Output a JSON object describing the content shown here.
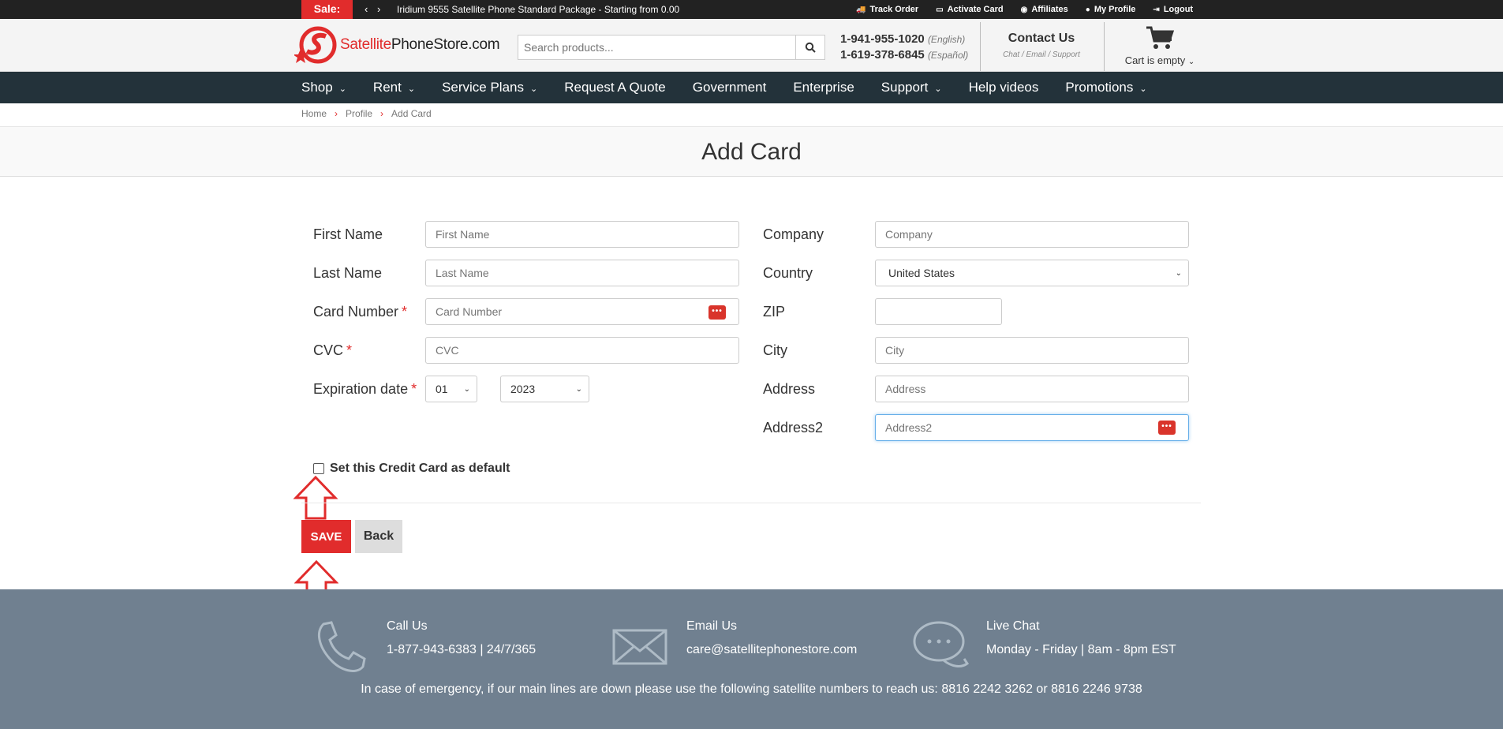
{
  "topbar": {
    "sale_label": "Sale:",
    "sale_arrows": "‹ ›",
    "sale_text": "Iridium 9555 Satellite Phone Standard Package - Starting from 0.00",
    "links": [
      "Track Order",
      "Activate Card",
      "Affiliates",
      "My Profile",
      "Logout"
    ]
  },
  "header": {
    "logo_text_1": "Satellite",
    "logo_text_2": "PhoneStore",
    "logo_text_3": ".com",
    "search_placeholder": "Search products...",
    "phone_en": "1-941-955-1020",
    "phone_en_lang": "(English)",
    "phone_es": "1-619-378-6845",
    "phone_es_lang": "(Español)",
    "contact_title": "Contact Us",
    "contact_sub": "Chat / Email / Support",
    "cart_label": "Cart is empty"
  },
  "nav": {
    "items": [
      {
        "label": "Shop",
        "dropdown": true
      },
      {
        "label": "Rent",
        "dropdown": true
      },
      {
        "label": "Service Plans",
        "dropdown": true
      },
      {
        "label": "Request A Quote",
        "dropdown": false
      },
      {
        "label": "Government",
        "dropdown": false
      },
      {
        "label": "Enterprise",
        "dropdown": false
      },
      {
        "label": "Support",
        "dropdown": true
      },
      {
        "label": "Help videos",
        "dropdown": false
      },
      {
        "label": "Promotions",
        "dropdown": true
      }
    ]
  },
  "breadcrumb": [
    "Home",
    "Profile",
    "Add Card"
  ],
  "page_title": "Add Card",
  "form": {
    "first_name_label": "First Name",
    "first_name_placeholder": "First Name",
    "last_name_label": "Last Name",
    "last_name_placeholder": "Last Name",
    "card_number_label": "Card Number",
    "card_number_placeholder": "Card Number",
    "cvc_label": "CVC",
    "cvc_placeholder": "CVC",
    "expiration_label": "Expiration date",
    "exp_month": "01",
    "exp_year": "2023",
    "company_label": "Company",
    "company_placeholder": "Company",
    "country_label": "Country",
    "country_value": "United States",
    "zip_label": "ZIP",
    "city_label": "City",
    "city_placeholder": "City",
    "address_label": "Address",
    "address_placeholder": "Address",
    "address2_label": "Address2",
    "address2_placeholder": "Address2",
    "required_mark": "*",
    "default_checkbox_label": "Set this Credit Card as default",
    "save_label": "SAVE",
    "back_label": "Back"
  },
  "footer": {
    "call_title": "Call Us",
    "call_value": "1-877-943-6383 | 24/7/365",
    "email_title": "Email Us",
    "email_value": "care@satellitephonestore.com",
    "chat_title": "Live Chat",
    "chat_value": "Monday - Friday | 8am - 8pm EST",
    "emergency": "In case of emergency, if our main lines are down please use the following satellite numbers to reach us: 8816 2242 3262 or 8816 2246 9738"
  },
  "colors": {
    "brand_red": "#e12c2c",
    "nav_bg": "#23323a",
    "footer_bg": "#708090"
  }
}
